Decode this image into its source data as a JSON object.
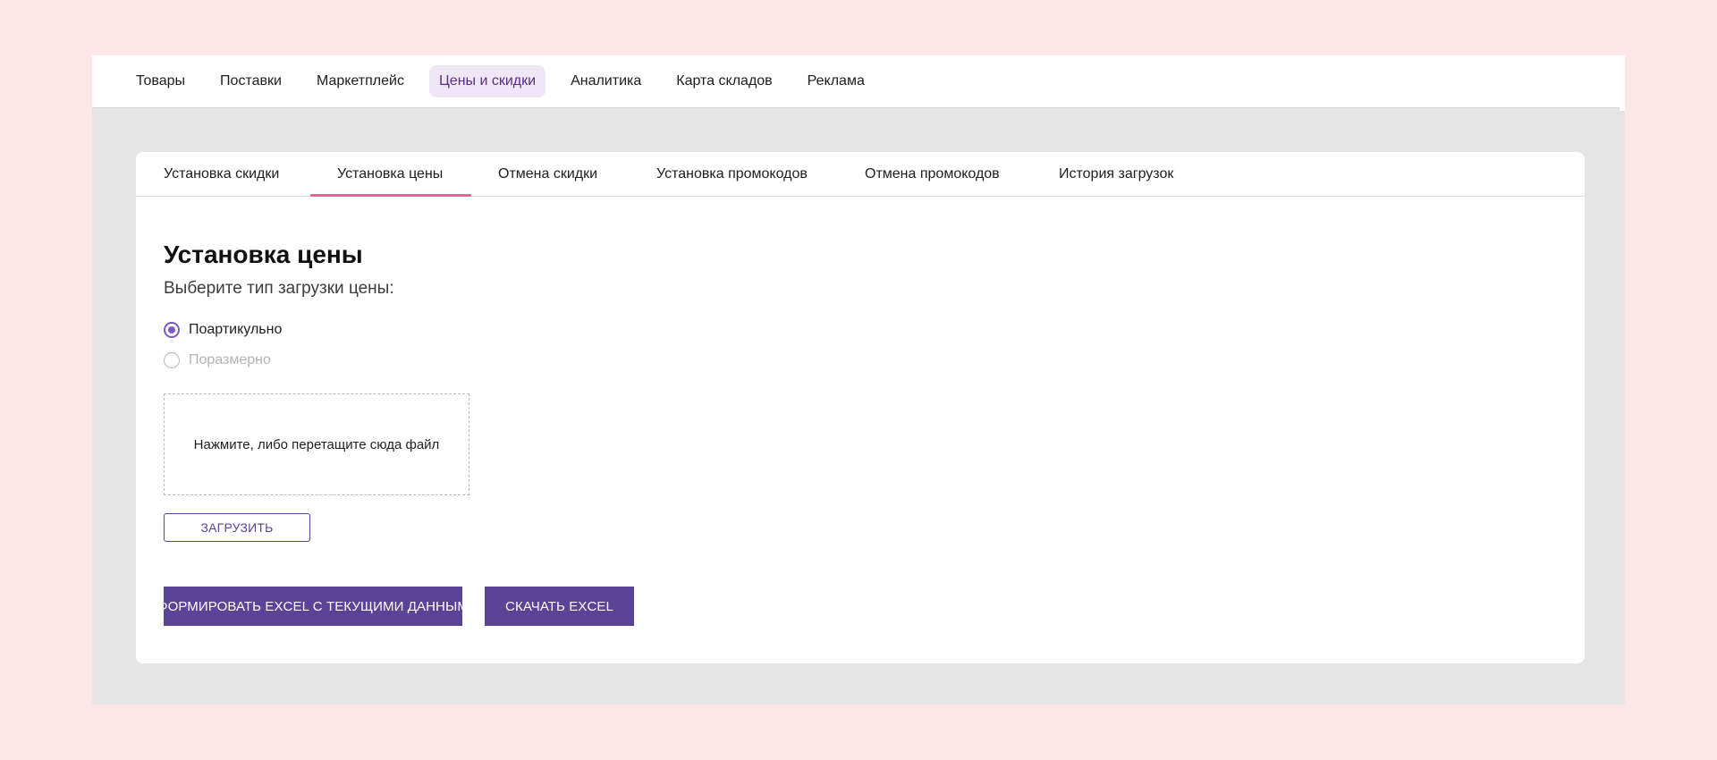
{
  "topnav": {
    "items": [
      {
        "label": "Товары"
      },
      {
        "label": "Поставки"
      },
      {
        "label": "Маркетплейс"
      },
      {
        "label": "Цены и скидки",
        "active": true
      },
      {
        "label": "Аналитика"
      },
      {
        "label": "Карта складов"
      },
      {
        "label": "Реклама"
      }
    ]
  },
  "tabs": [
    {
      "label": "Установка скидки"
    },
    {
      "label": "Установка цены",
      "active": true
    },
    {
      "label": "Отмена скидки"
    },
    {
      "label": "Установка промокодов"
    },
    {
      "label": "Отмена промокодов"
    },
    {
      "label": "История загрузок"
    }
  ],
  "content": {
    "title": "Установка цены",
    "subtitle": "Выберите тип загрузки цены:",
    "radio_options": [
      {
        "label": "Поартикульно",
        "checked": true,
        "disabled": false
      },
      {
        "label": "Поразмерно",
        "checked": false,
        "disabled": true
      }
    ],
    "dropzone_text": "Нажмите, либо перетащите сюда файл",
    "upload_button": "ЗАГРУЗИТЬ",
    "generate_excel_button": "СФОРМИРОВАТЬ EXCEL С ТЕКУЩИМИ ДАННЫМИ",
    "download_excel_button": "СКАЧАТЬ EXCEL"
  },
  "colors": {
    "page_background": "#fce6e8",
    "accent_purple": "#5b4396",
    "radio_purple": "#7f59c8",
    "active_tab_underline": "#e8609c",
    "active_nav_background": "#efe7f5"
  }
}
